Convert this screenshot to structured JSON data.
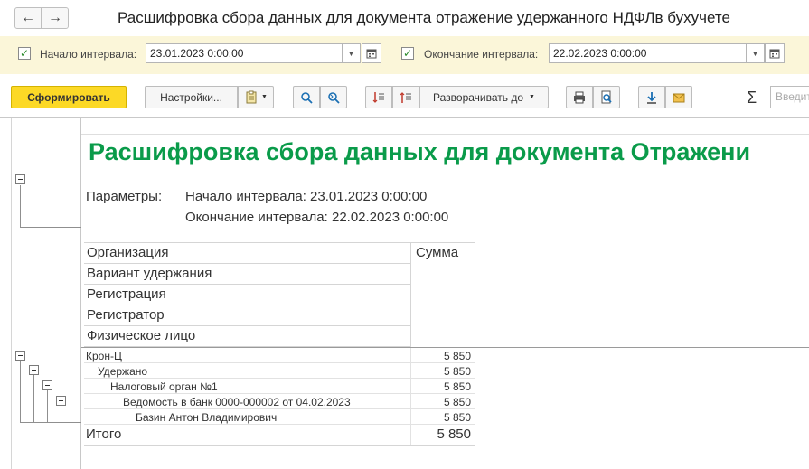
{
  "window": {
    "title": "Расшифровка сбора данных для документа отражение удержанного НДФЛв бухучете"
  },
  "params": {
    "start": {
      "label": "Начало интервала:",
      "value": "23.01.2023  0:00:00",
      "checked": true
    },
    "end": {
      "label": "Окончание интервала:",
      "value": "22.02.2023  0:00:00",
      "checked": true
    }
  },
  "toolbar": {
    "form_label": "Сформировать",
    "settings_label": "Настройки...",
    "expand_label": "Разворачивать до",
    "search_placeholder": "Введит"
  },
  "report": {
    "title": "Расшифровка сбора данных для документа Отражени",
    "params_label": "Параметры:",
    "param_lines": [
      "Начало интервала: 23.01.2023 0:00:00",
      "Окончание интервала: 22.02.2023 0:00:00"
    ],
    "header_groups": [
      "Организация",
      "Вариант удержания",
      "Регистрация",
      "Регистратор",
      "Физическое лицо"
    ],
    "header_sum": "Сумма",
    "rows": [
      {
        "name": "Крон-Ц",
        "value": "5 850"
      },
      {
        "name": "Удержано",
        "value": "5 850"
      },
      {
        "name": "Налоговый орган №1",
        "value": "5 850"
      },
      {
        "name": "Ведомость в банк 0000-000002 от 04.02.2023",
        "value": "5 850"
      },
      {
        "name": "Базин Антон Владимирович",
        "value": "5 850"
      }
    ],
    "total": {
      "label": "Итого",
      "value": "5 850"
    }
  },
  "colors": {
    "accent_button": "#fcd926",
    "report_title": "#0a9b4a",
    "params_bg": "#fbf6d9",
    "checkbox_mark": "#2a8a2a"
  }
}
